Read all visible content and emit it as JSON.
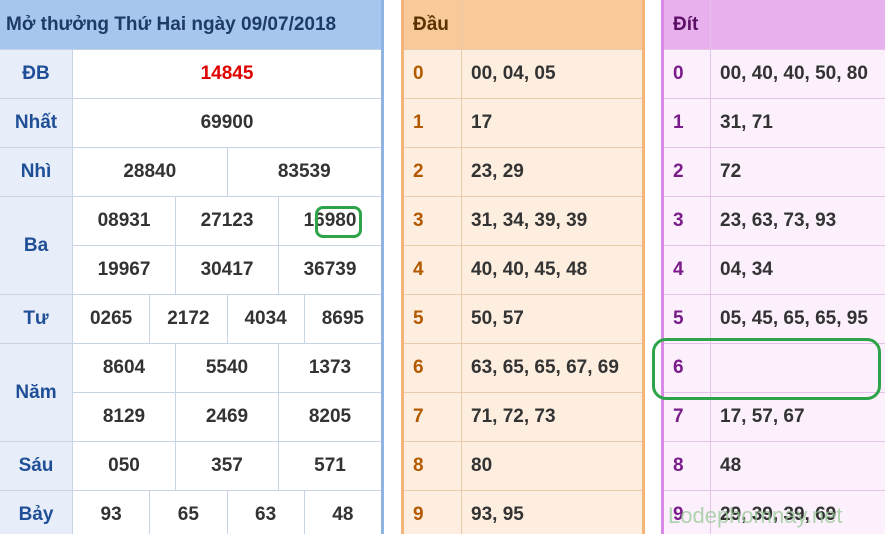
{
  "results": {
    "title": "Mở thưởng Thứ Hai ngày 09/07/2018",
    "prizes": [
      {
        "key": "db",
        "label": "ĐB",
        "rows": [
          [
            "14845"
          ]
        ]
      },
      {
        "key": "nhat",
        "label": "Nhất",
        "rows": [
          [
            "69900"
          ]
        ]
      },
      {
        "key": "nhi",
        "label": "Nhì",
        "rows": [
          [
            "28840",
            "83539"
          ]
        ]
      },
      {
        "key": "ba",
        "label": "Ba",
        "rows": [
          [
            "08931",
            "27123",
            "16980"
          ],
          [
            "19967",
            "30417",
            "36739"
          ]
        ]
      },
      {
        "key": "tu",
        "label": "Tư",
        "rows": [
          [
            "0265",
            "2172",
            "4034",
            "8695"
          ]
        ]
      },
      {
        "key": "nam",
        "label": "Năm",
        "rows": [
          [
            "8604",
            "5540",
            "1373"
          ],
          [
            "8129",
            "2469",
            "8205"
          ]
        ]
      },
      {
        "key": "sau",
        "label": "Sáu",
        "rows": [
          [
            "050",
            "357",
            "571"
          ]
        ]
      },
      {
        "key": "bay",
        "label": "Bảy",
        "rows": [
          [
            "93",
            "65",
            "63",
            "48"
          ]
        ]
      }
    ]
  },
  "dau": {
    "header": "Đầu",
    "rows": [
      {
        "digit": "0",
        "values": "00, 04, 05"
      },
      {
        "digit": "1",
        "values": "17"
      },
      {
        "digit": "2",
        "values": "23, 29"
      },
      {
        "digit": "3",
        "values": "31, 34, 39, 39"
      },
      {
        "digit": "4",
        "values": "40, 40, 45, 48"
      },
      {
        "digit": "5",
        "values": "50, 57"
      },
      {
        "digit": "6",
        "values": "63, 65, 65, 67, 69"
      },
      {
        "digit": "7",
        "values": "71, 72, 73"
      },
      {
        "digit": "8",
        "values": "80"
      },
      {
        "digit": "9",
        "values": "93, 95"
      }
    ]
  },
  "dit": {
    "header": "Đít",
    "rows": [
      {
        "digit": "0",
        "values": "00, 40, 40, 50, 80"
      },
      {
        "digit": "1",
        "values": "31, 71"
      },
      {
        "digit": "2",
        "values": "72"
      },
      {
        "digit": "3",
        "values": "23, 63, 73, 93"
      },
      {
        "digit": "4",
        "values": "04, 34"
      },
      {
        "digit": "5",
        "values": "05, 45, 65, 65, 95"
      },
      {
        "digit": "6",
        "values": ""
      },
      {
        "digit": "7",
        "values": "17, 57, 67"
      },
      {
        "digit": "8",
        "values": "48"
      },
      {
        "digit": "9",
        "values": "29, 39, 39, 69"
      }
    ]
  },
  "watermark": "Lodephomnay.net",
  "colors": {
    "special_prize": "#e00000",
    "highlight_ring": "#2ea44a"
  }
}
